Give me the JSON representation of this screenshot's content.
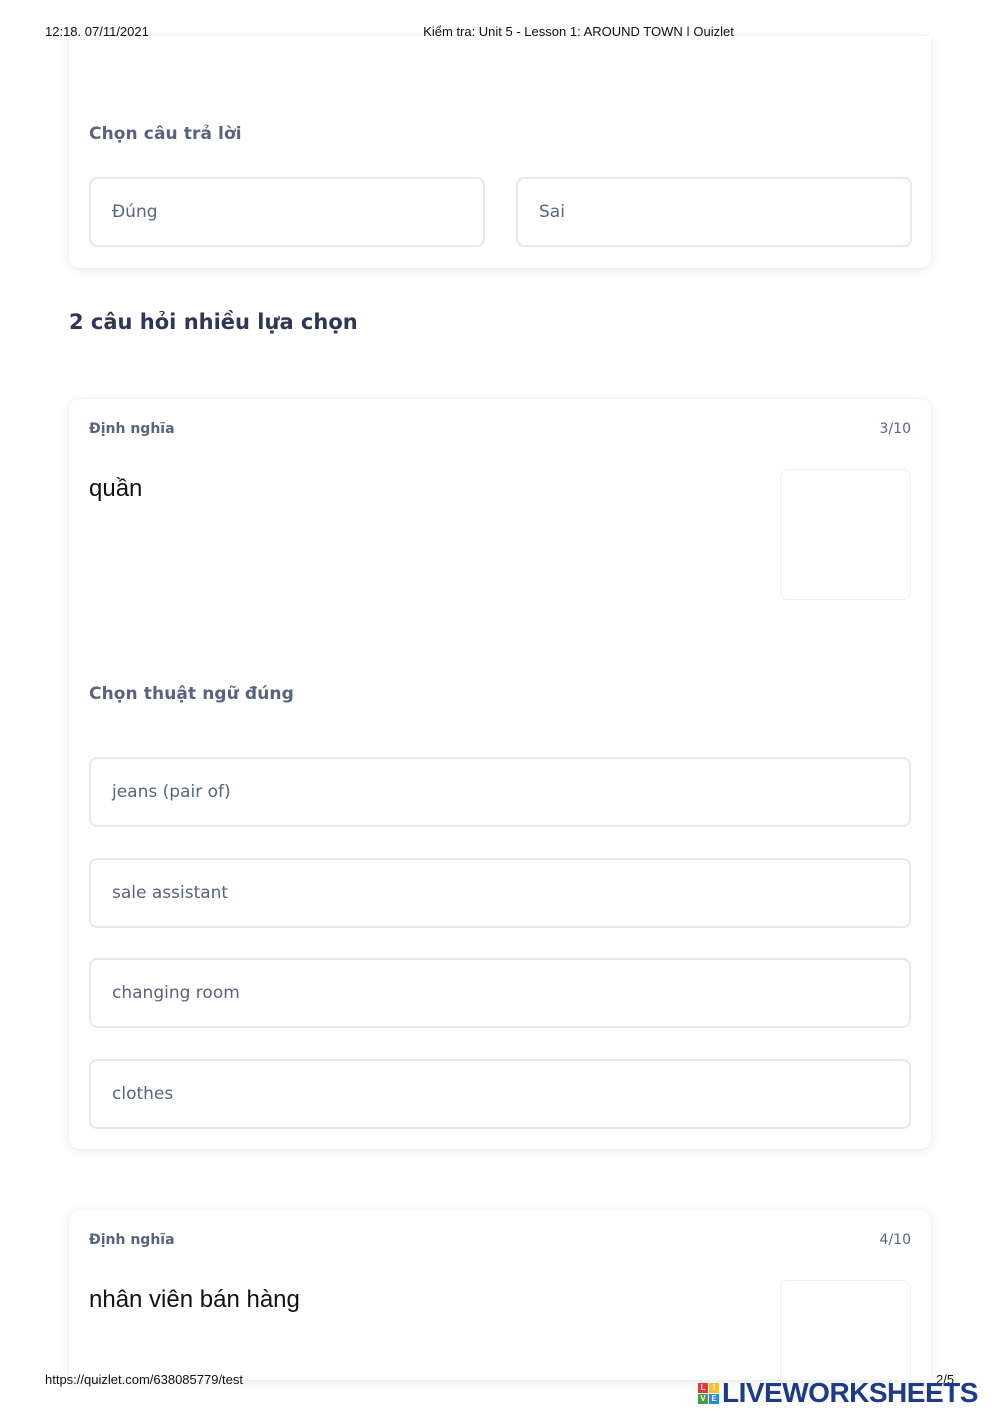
{
  "print_header": {
    "timestamp": "12:18, 07/11/2021",
    "document_title": "Kiểm tra: Unit 5 - Lesson 1: AROUND TOWN | Quizlet"
  },
  "true_false_card": {
    "prompt": "Chọn câu trả lời",
    "options": [
      "Đúng",
      "Sai"
    ]
  },
  "multiple_choice_section": {
    "title": "2 câu hỏi nhiều lựa chọn"
  },
  "question_3": {
    "label": "Định nghĩa",
    "counter": "3/10",
    "term": "quần",
    "prompt": "Chọn thuật ngữ đúng",
    "options": [
      "jeans (pair of)",
      "sale assistant",
      "changing room",
      "clothes"
    ]
  },
  "question_4": {
    "label": "Định nghĩa",
    "counter": "4/10",
    "term": "nhân viên bán hàng"
  },
  "print_footer": {
    "url": "https://quizlet.com/638085779/test",
    "page": "2/5"
  },
  "watermark": {
    "text": "LIVEWORKSHEETS",
    "badge_letters": [
      "L",
      "I",
      "V",
      "E"
    ],
    "badge_colors": [
      "#e53935",
      "#fbc02d",
      "#43a047",
      "#1e88e5"
    ]
  }
}
